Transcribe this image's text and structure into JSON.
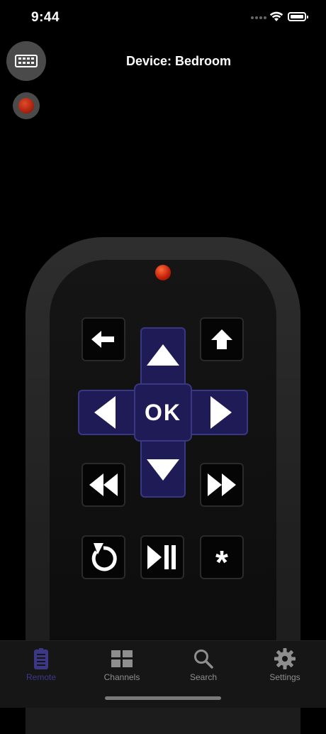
{
  "status_bar": {
    "time": "9:44"
  },
  "header": {
    "title": "Device: Bedroom"
  },
  "controls": {
    "keyboard": "keyboard-icon",
    "power": "power-icon"
  },
  "dpad": {
    "ok_label": "OK"
  },
  "remote_buttons": {
    "back": "back-arrow-icon",
    "home": "home-icon",
    "rewind": "rewind-icon",
    "fast_forward": "fast-forward-icon",
    "replay": "replay-icon",
    "play_pause": "play-pause-icon",
    "options": "*"
  },
  "tabs": [
    {
      "label": "Remote",
      "icon": "remote-icon",
      "active": true
    },
    {
      "label": "Channels",
      "icon": "channels-grid-icon",
      "active": false
    },
    {
      "label": "Search",
      "icon": "search-icon",
      "active": false
    },
    {
      "label": "Settings",
      "icon": "gear-icon",
      "active": false
    }
  ],
  "colors": {
    "accent": "#3c3887",
    "dpad": "#1e1b57",
    "led": "#c01e08"
  }
}
